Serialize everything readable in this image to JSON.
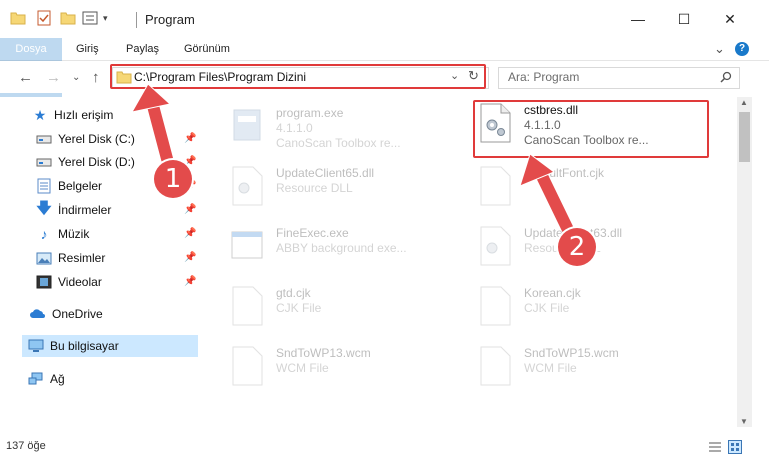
{
  "window": {
    "title": "Program",
    "minimize_glyph": "—",
    "maximize_glyph": "☐",
    "close_glyph": "✕"
  },
  "ribbon": {
    "tabs": [
      "Dosya",
      "Giriş",
      "Paylaş",
      "Görünüm"
    ],
    "help_glyph": "?",
    "expand_glyph": "⌄"
  },
  "address": {
    "path": "C:\\Program Files\\Program Dizini",
    "search_placeholder": "Ara: Program"
  },
  "sidebar": {
    "quick_access": "Hızlı erişim",
    "items": [
      {
        "label": "Yerel Disk (C:)",
        "icon": "drive-icon"
      },
      {
        "label": "Yerel Disk (D:)",
        "icon": "drive-icon"
      },
      {
        "label": "Belgeler",
        "icon": "documents-icon"
      },
      {
        "label": "İndirmeler",
        "icon": "downloads-icon"
      },
      {
        "label": "Müzik",
        "icon": "music-icon"
      },
      {
        "label": "Resimler",
        "icon": "pictures-icon"
      },
      {
        "label": "Videolar",
        "icon": "videos-icon"
      }
    ],
    "onedrive": "OneDrive",
    "this_pc": "Bu bilgisayar",
    "network": "Ağ"
  },
  "files": [
    {
      "name": "program.exe",
      "line2": "4.1.1.0",
      "line3": "CanoScan Toolbox re..."
    },
    {
      "name": "cstbres.dll",
      "line2": "4.1.1.0",
      "line3": "CanoScan Toolbox re..."
    },
    {
      "name": "UpdateClient65.dll",
      "line2": "Resource DLL",
      "line3": ""
    },
    {
      "name": "DefaultFont.cjk",
      "line2": "",
      "line3": ""
    },
    {
      "name": "FineExec.exe",
      "line2": "ABBY background exe...",
      "line3": ""
    },
    {
      "name": "UpdateClient63.dll",
      "line2": "Resource DLL",
      "line3": ""
    },
    {
      "name": "gtd.cjk",
      "line2": "CJK File",
      "line3": ""
    },
    {
      "name": "Korean.cjk",
      "line2": "CJK File",
      "line3": ""
    },
    {
      "name": "SndToWP13.wcm",
      "line2": "WCM File",
      "line3": ""
    },
    {
      "name": "SndToWP15.wcm",
      "line2": "WCM File",
      "line3": ""
    }
  ],
  "status": {
    "item_count": "137 öğe"
  },
  "annotations": {
    "marker1": "1",
    "marker2": "2",
    "color": "#e03a3a"
  }
}
